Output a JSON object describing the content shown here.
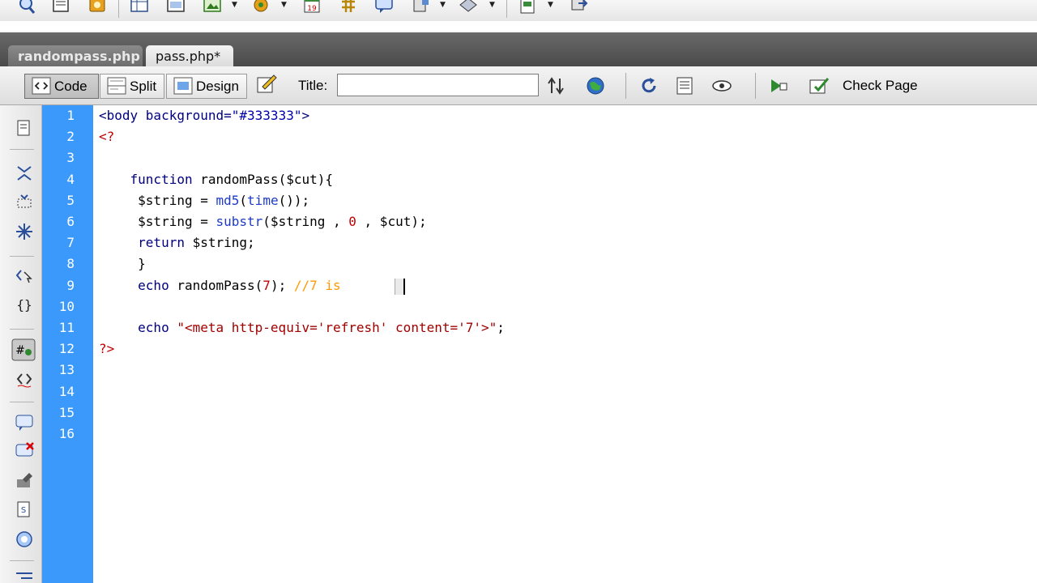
{
  "top_toolbar": {
    "icons": [
      "zoom-tool-icon",
      "new-document-icon",
      "library-icon",
      "table-icon",
      "layout-icon",
      "insert-image-icon",
      "media-icon",
      "date-icon",
      "grid-icon",
      "comment-icon",
      "server-icon",
      "template-icon",
      "snippet-icon",
      "transfer-icon"
    ]
  },
  "tabs": [
    {
      "label": "randompass.php",
      "active": false
    },
    {
      "label": "pass.php*",
      "active": true
    }
  ],
  "doc_toolbar": {
    "code_label": "Code",
    "split_label": "Split",
    "design_label": "Design",
    "title_label": "Title:",
    "title_value": "",
    "check_page_label": "Check Page",
    "active_view": "Code"
  },
  "coding_toolbar": {
    "icons": [
      "open-documents-icon",
      "collapse-full-tag-icon",
      "collapse-selection-icon",
      "expand-all-icon",
      "select-parent-tag-icon",
      "balance-braces-icon",
      "line-numbers-icon",
      "highlight-invalid-code-icon",
      "apply-comment-icon",
      "remove-comment-icon",
      "wrap-tag-icon",
      "recent-snippets-icon",
      "format-source-icon",
      "indent-icon"
    ]
  },
  "editor": {
    "line_numbers": [
      "1",
      "2",
      "3",
      "4",
      "5",
      "6",
      "7",
      "8",
      "9",
      "10",
      "11",
      "12",
      "13",
      "14",
      "15",
      "16"
    ],
    "lines": [
      [
        {
          "t": "<body background=",
          "c": "c-tag"
        },
        {
          "t": "\"#333333\"",
          "c": "c-str"
        },
        {
          "t": ">",
          "c": "c-tag"
        }
      ],
      [
        {
          "t": "<?",
          "c": "c-php"
        }
      ],
      [],
      [
        {
          "t": "    function ",
          "c": "c-kw"
        },
        {
          "t": "randomPass",
          "c": "c-var"
        },
        {
          "t": "($cut){",
          "c": "c-punct"
        }
      ],
      [
        {
          "t": "     $string = ",
          "c": "c-var"
        },
        {
          "t": "md5",
          "c": "c-builtin"
        },
        {
          "t": "(",
          "c": "c-punct"
        },
        {
          "t": "time",
          "c": "c-builtin"
        },
        {
          "t": "());",
          "c": "c-punct"
        }
      ],
      [
        {
          "t": "     $string = ",
          "c": "c-var"
        },
        {
          "t": "substr",
          "c": "c-builtin"
        },
        {
          "t": "($string , ",
          "c": "c-punct"
        },
        {
          "t": "0",
          "c": "c-num"
        },
        {
          "t": " , $cut);",
          "c": "c-punct"
        }
      ],
      [
        {
          "t": "     return ",
          "c": "c-kw"
        },
        {
          "t": "$string;",
          "c": "c-var"
        }
      ],
      [
        {
          "t": "     }",
          "c": "c-punct"
        }
      ],
      [
        {
          "t": "     echo ",
          "c": "c-kw"
        },
        {
          "t": "randomPass(",
          "c": "c-var"
        },
        {
          "t": "7",
          "c": "c-num"
        },
        {
          "t": "); ",
          "c": "c-punct"
        },
        {
          "t": "//7 is ",
          "c": "c-comment"
        }
      ],
      [],
      [
        {
          "t": "     echo ",
          "c": "c-kw"
        },
        {
          "t": "\"<meta http-equiv='refresh' content='7'>\"",
          "c": "c-dstr"
        },
        {
          "t": ";",
          "c": "c-punct"
        }
      ],
      [
        {
          "t": "?>",
          "c": "c-php"
        }
      ],
      [],
      [],
      [],
      []
    ]
  },
  "colors": {
    "gutter": "#3b99fc",
    "tab_band": "#555555",
    "comment": "#ff9900",
    "php_delimiter": "#c00000"
  }
}
